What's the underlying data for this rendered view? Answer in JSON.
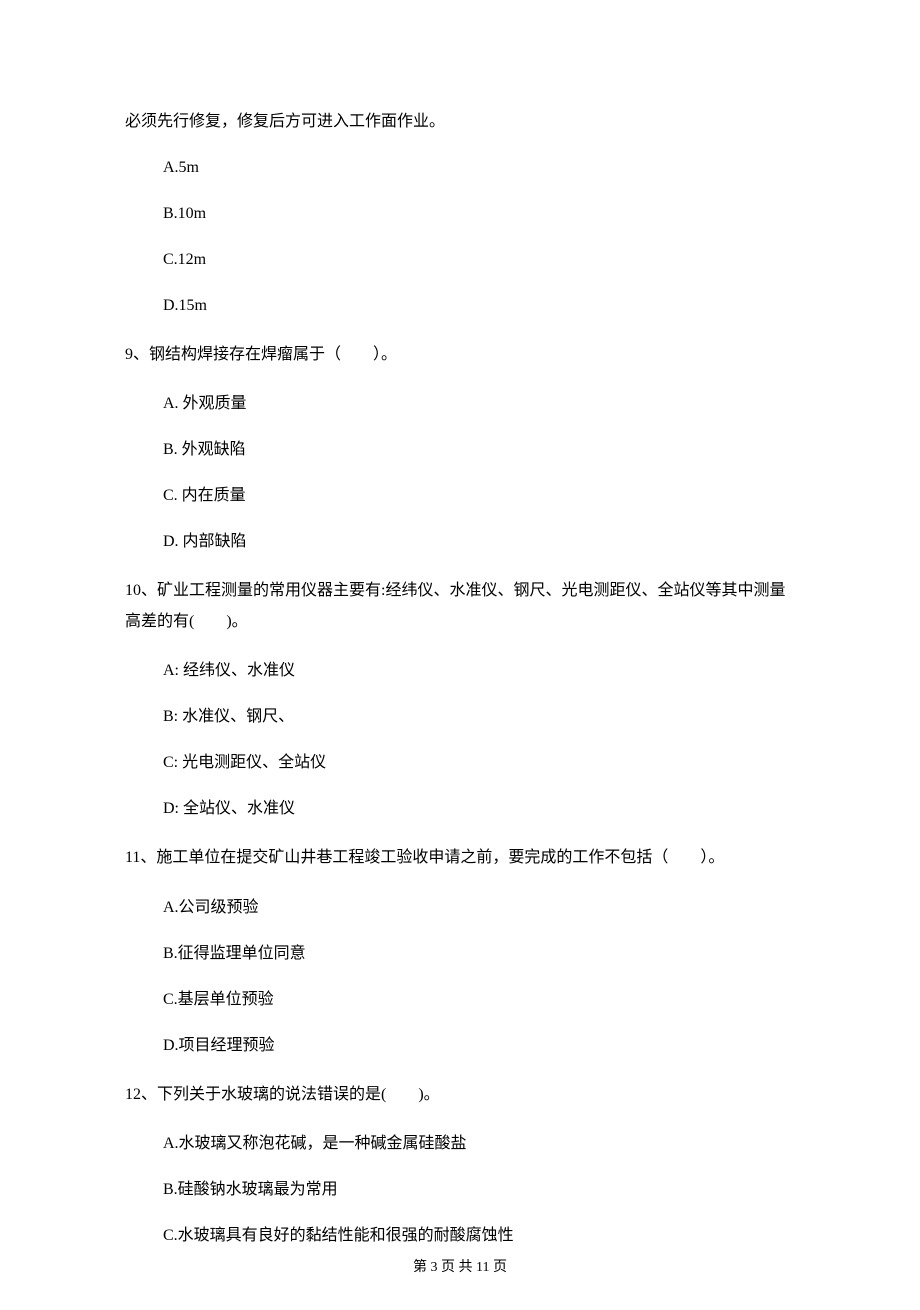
{
  "introLine": "必须先行修复，修复后方可进入工作面作业。",
  "q8options": {
    "a": "A.5m",
    "b": "B.10m",
    "c": "C.12m",
    "d": "D.15m"
  },
  "q9": {
    "text": "9、钢结构焊接存在焊瘤属于（　　）。",
    "a": "A. 外观质量",
    "b": "B. 外观缺陷",
    "c": "C. 内在质量",
    "d": "D. 内部缺陷"
  },
  "q10": {
    "text": "10、矿业工程测量的常用仪器主要有:经纬仪、水准仪、钢尺、光电测距仪、全站仪等其中测量高差的有(　　)。",
    "a": "A: 经纬仪、水准仪",
    "b": "B: 水准仪、钢尺、",
    "c": "C: 光电测距仪、全站仪",
    "d": "D: 全站仪、水准仪"
  },
  "q11": {
    "text": "11、施工单位在提交矿山井巷工程竣工验收申请之前，要完成的工作不包括（　　）。",
    "a": "A.公司级预验",
    "b": "B.征得监理单位同意",
    "c": "C.基层单位预验",
    "d": "D.项目经理预验"
  },
  "q12": {
    "text": "12、下列关于水玻璃的说法错误的是(　　)。",
    "a": "A.水玻璃又称泡花碱，是一种碱金属硅酸盐",
    "b": "B.硅酸钠水玻璃最为常用",
    "c": "C.水玻璃具有良好的黏结性能和很强的耐酸腐蚀性"
  },
  "footer": "第 3 页 共 11 页"
}
